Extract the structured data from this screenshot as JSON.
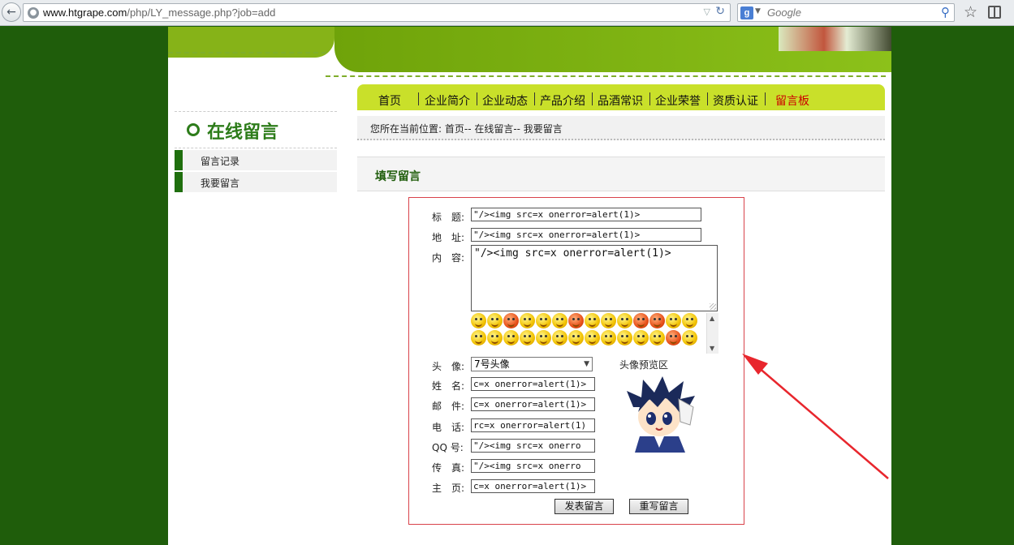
{
  "browser": {
    "url_host": "www.htgrape.com",
    "url_path": "/php/LY_message.php?job=add",
    "search_placeholder": "Google",
    "search_engine_icon": "google-icon"
  },
  "nav": {
    "items": [
      {
        "label": "首页",
        "active": false
      },
      {
        "label": "企业简介",
        "active": false
      },
      {
        "label": "企业动态",
        "active": false
      },
      {
        "label": "产品介绍",
        "active": false
      },
      {
        "label": "品酒常识",
        "active": false
      },
      {
        "label": "企业荣誉",
        "active": false
      },
      {
        "label": "资质认证",
        "active": false
      },
      {
        "label": "留言板",
        "active": true
      }
    ]
  },
  "sidebar": {
    "title": "在线留言",
    "items": [
      {
        "label": "留言记录"
      },
      {
        "label": "我要留言"
      }
    ]
  },
  "breadcrumb": {
    "text": "您所在当前位置: 首页-- 在线留言-- 我要留言"
  },
  "section": {
    "title": "填写留言"
  },
  "form": {
    "labels": {
      "title": "标　题:",
      "address": "地　址:",
      "content": "内　容:",
      "avatar": "头　像:",
      "name": "姓　名:",
      "email": "邮　件:",
      "phone": "电　话:",
      "qq": "QQ 号:",
      "fax": "传　真:",
      "homepage": "主　页:"
    },
    "values": {
      "title": "\"/><img src=x onerror=alert(1)>",
      "address": "\"/><img src=x onerror=alert(1)>",
      "content": "\"/><img src=x onerror=alert(1)>",
      "name": "c=x onerror=alert(1)>",
      "email": "c=x onerror=alert(1)>",
      "phone": "rc=x onerror=alert(1)",
      "qq": "\"/><img src=x onerro",
      "fax": "\"/><img src=x onerro",
      "homepage": "c=x onerror=alert(1)>"
    },
    "avatar_select": "7号头像",
    "preview_label": "头像预览区",
    "submit_label": "发表留言",
    "reset_label": "重写留言"
  },
  "annotation": {
    "arrow_color": "#e8262d"
  }
}
